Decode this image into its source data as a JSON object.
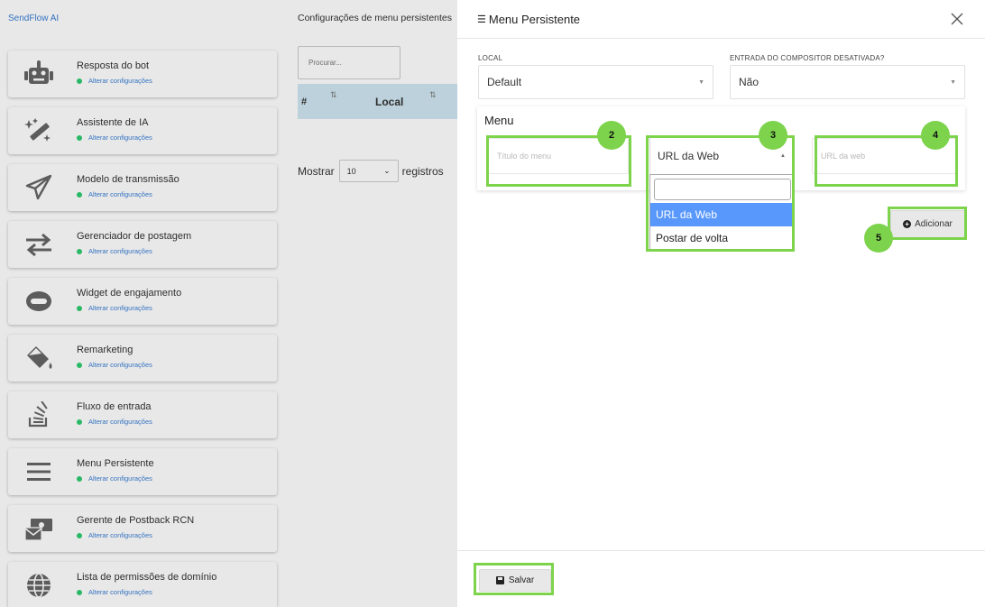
{
  "brand": "SendFlow AI",
  "sidebar": {
    "sub_label": "Alterar configurações",
    "items": [
      {
        "label": "Resposta do bot",
        "icon": "robot-icon"
      },
      {
        "label": "Assistente de IA",
        "icon": "magic-wand-icon"
      },
      {
        "label": "Modelo de transmissão",
        "icon": "paper-plane-icon"
      },
      {
        "label": "Gerenciador de postagem",
        "icon": "exchange-arrows-icon"
      },
      {
        "label": "Widget de engajamento",
        "icon": "ring-icon"
      },
      {
        "label": "Remarketing",
        "icon": "paint-bucket-icon"
      },
      {
        "label": "Fluxo de entrada",
        "icon": "stack-overflow-icon"
      },
      {
        "label": "Menu Persistente",
        "icon": "hamburger-menu-icon"
      },
      {
        "label": "Gerente de Postback RCN",
        "icon": "money-envelope-icon"
      },
      {
        "label": "Lista de permissões de domínio",
        "icon": "globe-icon"
      }
    ]
  },
  "center": {
    "title": "Configurações de menu persistentes",
    "search_placeholder": "Procurar...",
    "table_headers": [
      "#",
      "Local"
    ],
    "show_label": "Mostrar",
    "page_size": "10",
    "records_label": "registros"
  },
  "modal": {
    "title": "Menu Persistente",
    "local_label": "LOCAL",
    "local_value": "Default",
    "composer_label": "ENTRADA DO COMPOSITOR DESATIVADA?",
    "composer_value": "Não",
    "menu_label": "Menu",
    "menu_title_placeholder": "Título do menu",
    "type_value": "URL da Web",
    "type_options": [
      "URL da Web",
      "Postar de volta"
    ],
    "url_placeholder": "URL da web",
    "add_label": "Adicionar",
    "save_label": "Salvar"
  },
  "badges": [
    "2",
    "3",
    "4",
    "5"
  ],
  "colors": {
    "highlight": "#7dd34c",
    "option_active": "#5897fb",
    "link": "#3a7fd5",
    "status_dot": "#2ecc71"
  }
}
